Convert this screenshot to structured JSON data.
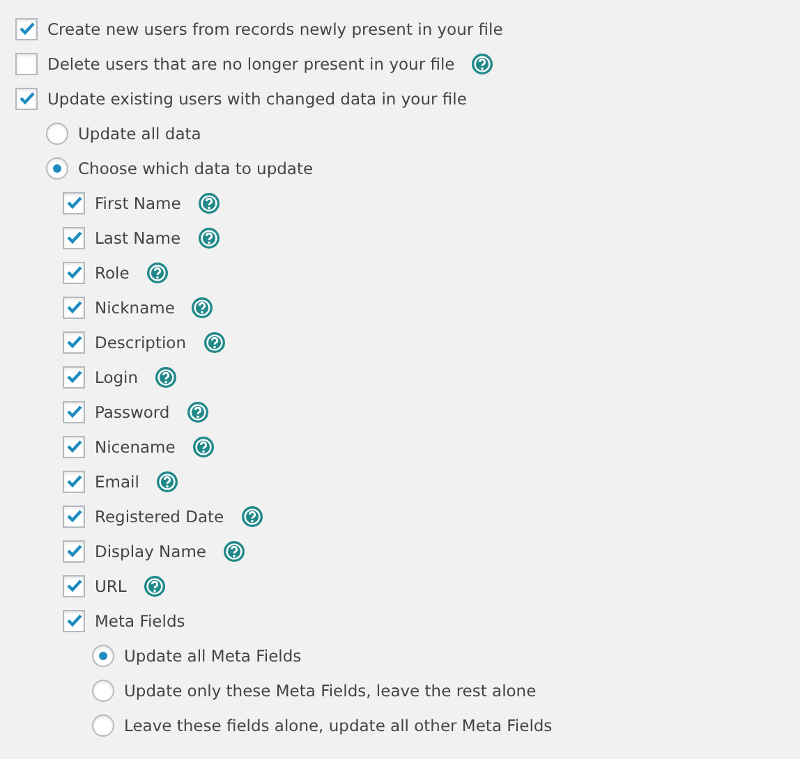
{
  "options": [
    {
      "label": "Create new users from records newly present in your file",
      "checked": true,
      "help": false
    },
    {
      "label": "Delete users that are no longer present in your file",
      "checked": false,
      "help": true
    },
    {
      "label": "Update existing users with changed data in your file",
      "checked": true,
      "help": false
    }
  ],
  "update_mode": [
    {
      "label": "Update all data",
      "selected": false
    },
    {
      "label": "Choose which data to update",
      "selected": true
    }
  ],
  "fields": [
    {
      "label": "First Name",
      "checked": true,
      "help": true
    },
    {
      "label": "Last Name",
      "checked": true,
      "help": true
    },
    {
      "label": "Role",
      "checked": true,
      "help": true
    },
    {
      "label": "Nickname",
      "checked": true,
      "help": true
    },
    {
      "label": "Description",
      "checked": true,
      "help": true
    },
    {
      "label": "Login",
      "checked": true,
      "help": true
    },
    {
      "label": "Password",
      "checked": true,
      "help": true
    },
    {
      "label": "Nicename",
      "checked": true,
      "help": true
    },
    {
      "label": "Email",
      "checked": true,
      "help": true
    },
    {
      "label": "Registered Date",
      "checked": true,
      "help": true
    },
    {
      "label": "Display Name",
      "checked": true,
      "help": true
    },
    {
      "label": "URL",
      "checked": true,
      "help": true
    },
    {
      "label": "Meta Fields",
      "checked": true,
      "help": false
    }
  ],
  "meta_mode": [
    {
      "label": "Update all Meta Fields",
      "selected": true
    },
    {
      "label": "Update only these Meta Fields, leave the rest alone",
      "selected": false
    },
    {
      "label": "Leave these fields alone, update all other Meta Fields",
      "selected": false
    }
  ]
}
